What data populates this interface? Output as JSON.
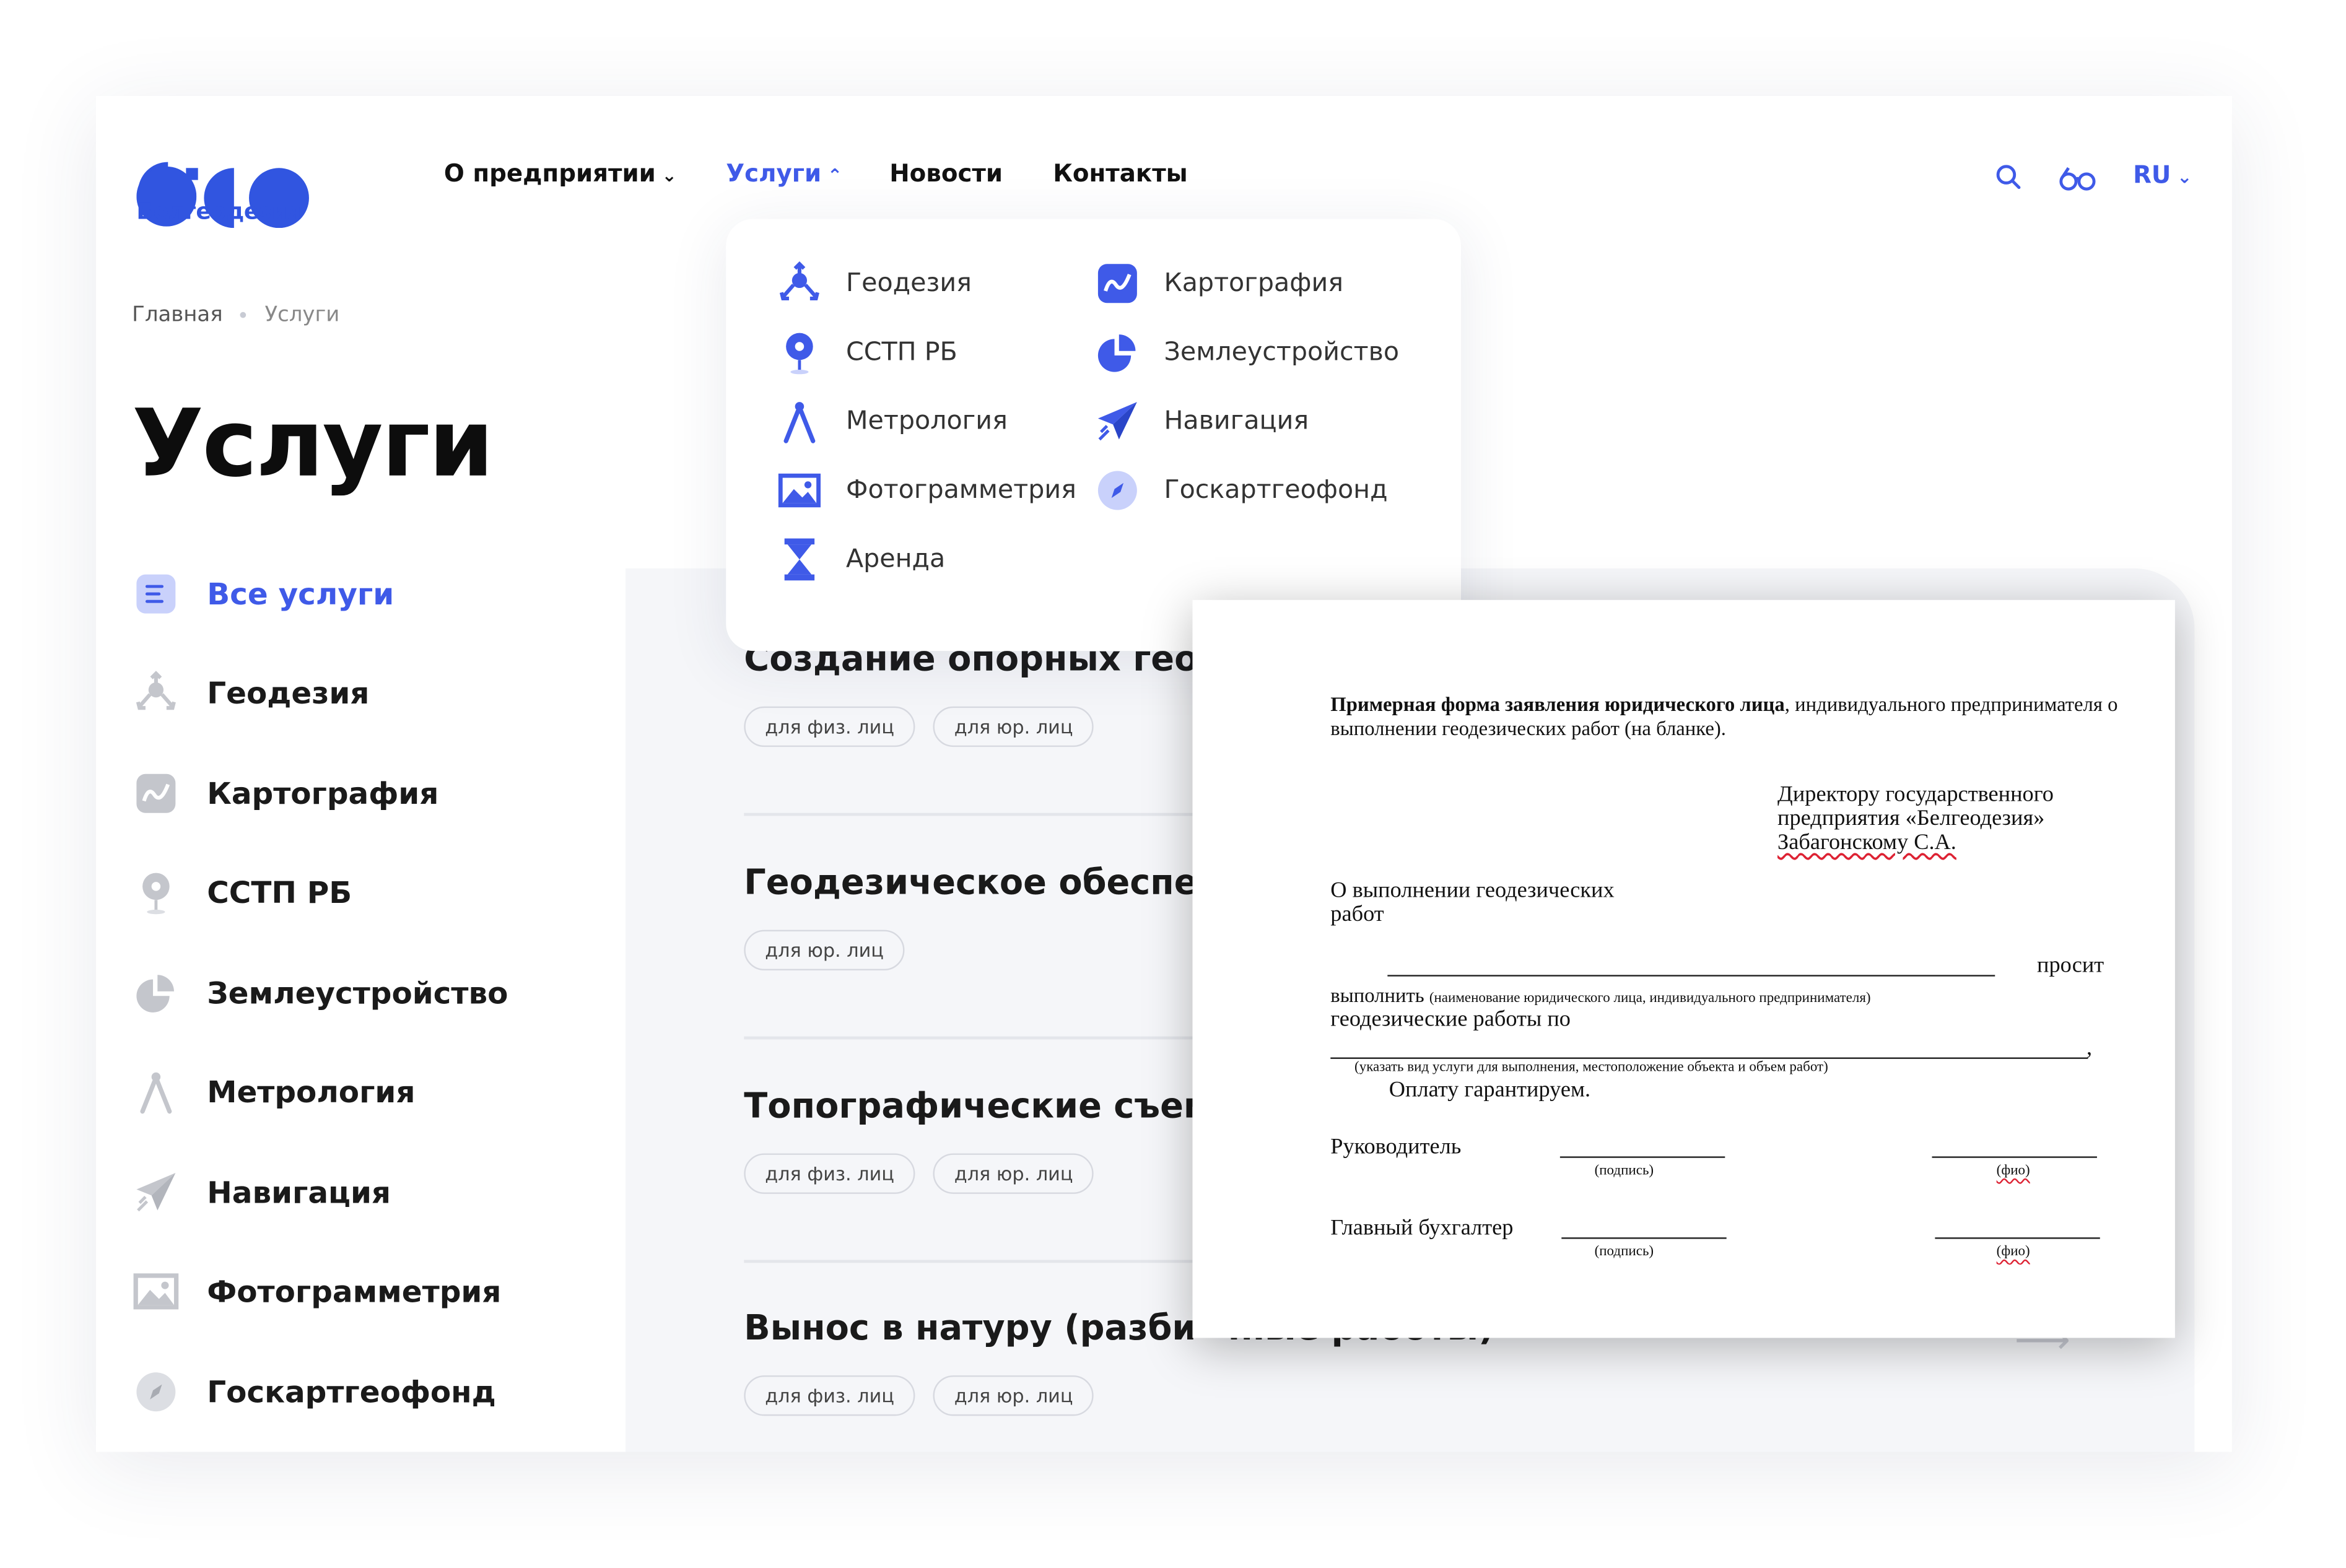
{
  "brand": {
    "name": "Белгеодезия",
    "color": "#3155e0"
  },
  "nav": {
    "items": [
      {
        "label": "О предприятии",
        "chevron": "chevron-down"
      },
      {
        "label": "Услуги",
        "chevron": "chevron-up",
        "active": true
      },
      {
        "label": "Новости"
      },
      {
        "label": "Контакты"
      }
    ],
    "language": "RU"
  },
  "breadcrumb": [
    "Главная",
    "Услуги"
  ],
  "page_title": "Услуги",
  "sidebar": {
    "items": [
      {
        "label": "Все услуги",
        "icon": "list-icon",
        "active": true
      },
      {
        "label": "Геодезия",
        "icon": "tripod-icon"
      },
      {
        "label": "Картография",
        "icon": "map-icon"
      },
      {
        "label": "ССТП РБ",
        "icon": "pin-icon"
      },
      {
        "label": "Землеустройство",
        "icon": "pie-icon"
      },
      {
        "label": "Метрология",
        "icon": "compass-icon"
      },
      {
        "label": "Навигация",
        "icon": "paper-plane-icon"
      },
      {
        "label": "Фотограмметрия",
        "icon": "image-icon"
      },
      {
        "label": "Госкартгеофонд",
        "icon": "compass-round-icon"
      }
    ]
  },
  "dropdown": {
    "left": [
      {
        "label": "Геодезия",
        "icon": "tripod-icon"
      },
      {
        "label": "ССТП РБ",
        "icon": "pin-icon"
      },
      {
        "label": "Метрология",
        "icon": "compass-icon"
      },
      {
        "label": "Фотограмметрия",
        "icon": "image-icon"
      },
      {
        "label": "Аренда",
        "icon": "hourglass-icon"
      }
    ],
    "right": [
      {
        "label": "Картография",
        "icon": "map-icon"
      },
      {
        "label": "Землеустройство",
        "icon": "pie-icon"
      },
      {
        "label": "Навигация",
        "icon": "paper-plane-icon"
      },
      {
        "label": "Госкартгеофонд",
        "icon": "compass-round-icon"
      }
    ]
  },
  "services": [
    {
      "title": "Создание опорных гео",
      "tags": [
        "для физ. лиц",
        "для юр. лиц"
      ]
    },
    {
      "title": "Геодезическое обеспе",
      "tags": [
        "для юр. лиц"
      ]
    },
    {
      "title": "Топографические съем",
      "tags": [
        "для физ. лиц",
        "для юр. лиц"
      ]
    },
    {
      "title": "Вынос в натуру (разби",
      "title_tail": "чные работы)",
      "tags": [
        "для физ. лиц",
        "для юр. лиц"
      ]
    }
  ],
  "document": {
    "heading_bold": "Примерная форма заявления юридического лица",
    "heading_rest": ", индивидуального предпринимателя о",
    "heading_line2": "выполнении геодезических работ (на бланке).",
    "addressee_1": "Директору государственного",
    "addressee_2": "предприятия «Белгеодезия»",
    "addressee_3": "Забагонскому С.А.",
    "subject_1": "О выполнении геодезических",
    "subject_2": "работ",
    "asks": "просит",
    "perform": "выполнить",
    "perform_note": "(наименование юридического лица, индивидуального предпринимателя)",
    "works_for": "геодезические работы по",
    "comma": ",",
    "works_note": "(указать вид услуги для выполнения, местоположение объекта и объем работ)",
    "guarantee": "Оплату гарантируем.",
    "signer_1": "Руководитель",
    "signer_2": "Главный бухгалтер",
    "signature": "(подпись)",
    "fio": "(фио)"
  },
  "colors": {
    "accent": "#3f5ae8",
    "panel": "#f5f6f9",
    "muted_icon": "#c4c6cc"
  }
}
